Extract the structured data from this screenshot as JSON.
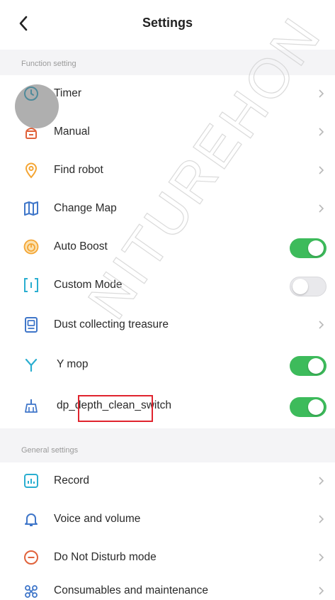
{
  "header": {
    "title": "Settings"
  },
  "sections": {
    "function": "Function setting",
    "general": "General settings"
  },
  "items": {
    "timer": "Timer",
    "manual": "Manual",
    "find_robot": "Find robot",
    "change_map": "Change Map",
    "auto_boost": "Auto Boost",
    "custom_mode": "Custom Mode",
    "dust": "Dust collecting treasure",
    "y_mop": "Y mop",
    "dp_prefix": "dp_",
    "dp_highlight": "depth_clean",
    "dp_suffix": "_switch",
    "record": "Record",
    "voice": "Voice and volume",
    "dnd": "Do Not Disturb mode",
    "consumables": "Consumables and maintenance"
  },
  "toggles": {
    "auto_boost": true,
    "custom_mode": false,
    "y_mop": true,
    "dp_depth_clean_switch": true
  },
  "watermark": {
    "text1": "NITURE",
    "text2": "HON"
  },
  "colors": {
    "accent_green": "#3dbb5b",
    "icon_orange": "#f4a533",
    "icon_blue": "#3f76c9",
    "icon_teal": "#2aaed0",
    "highlight_red": "#e0242e"
  }
}
